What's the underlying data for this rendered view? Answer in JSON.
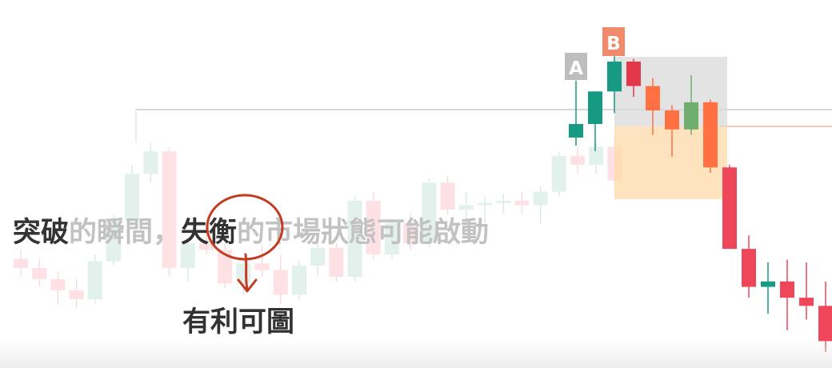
{
  "chart_data": {
    "type": "candlestick",
    "price_scale": [
      0,
      100
    ],
    "background_candles": [
      {
        "o": 38,
        "h": 42,
        "l": 30,
        "c": 34
      },
      {
        "o": 34,
        "h": 38,
        "l": 26,
        "c": 29
      },
      {
        "o": 29,
        "h": 32,
        "l": 18,
        "c": 24
      },
      {
        "o": 24,
        "h": 29,
        "l": 16,
        "c": 20
      },
      {
        "o": 20,
        "h": 40,
        "l": 18,
        "c": 37
      },
      {
        "o": 37,
        "h": 58,
        "l": 35,
        "c": 55
      },
      {
        "o": 55,
        "h": 80,
        "l": 52,
        "c": 76
      },
      {
        "o": 76,
        "h": 90,
        "l": 72,
        "c": 86
      },
      {
        "o": 86,
        "h": 88,
        "l": 30,
        "c": 34
      },
      {
        "o": 34,
        "h": 46,
        "l": 28,
        "c": 45
      },
      {
        "o": 45,
        "h": 52,
        "l": 40,
        "c": 42
      },
      {
        "o": 42,
        "h": 48,
        "l": 25,
        "c": 27
      },
      {
        "o": 27,
        "h": 38,
        "l": 22,
        "c": 36
      },
      {
        "o": 36,
        "h": 44,
        "l": 30,
        "c": 33
      },
      {
        "o": 33,
        "h": 40,
        "l": 18,
        "c": 22
      },
      {
        "o": 22,
        "h": 37,
        "l": 20,
        "c": 35
      },
      {
        "o": 35,
        "h": 46,
        "l": 30,
        "c": 43
      },
      {
        "o": 43,
        "h": 45,
        "l": 28,
        "c": 30
      },
      {
        "o": 30,
        "h": 66,
        "l": 28,
        "c": 64
      },
      {
        "o": 64,
        "h": 68,
        "l": 38,
        "c": 40
      },
      {
        "o": 40,
        "h": 56,
        "l": 38,
        "c": 54
      },
      {
        "o": 54,
        "h": 58,
        "l": 42,
        "c": 45
      },
      {
        "o": 45,
        "h": 74,
        "l": 43,
        "c": 72
      },
      {
        "o": 72,
        "h": 75,
        "l": 58,
        "c": 60
      },
      {
        "o": 60,
        "h": 68,
        "l": 50,
        "c": 62
      },
      {
        "o": 62,
        "h": 66,
        "l": 54,
        "c": 63
      },
      {
        "o": 63,
        "h": 67,
        "l": 58,
        "c": 64
      },
      {
        "o": 64,
        "h": 68,
        "l": 58,
        "c": 62
      },
      {
        "o": 62,
        "h": 70,
        "l": 54,
        "c": 68
      },
      {
        "o": 68,
        "h": 86,
        "l": 66,
        "c": 84
      },
      {
        "o": 84,
        "h": 88,
        "l": 76,
        "c": 80
      },
      {
        "o": 80,
        "h": 90,
        "l": 76,
        "c": 88
      },
      {
        "o": 88,
        "h": 92,
        "l": 70,
        "c": 73
      }
    ],
    "candles": [
      {
        "o": 79,
        "h": 100,
        "l": 76,
        "c": 84
      },
      {
        "o": 84,
        "h": 91,
        "l": 74,
        "c": 96
      },
      {
        "o": 96,
        "h": 112,
        "l": 88,
        "c": 107
      },
      {
        "o": 107,
        "h": 108,
        "l": 94,
        "c": 98
      },
      {
        "o": 98,
        "h": 101,
        "l": 80,
        "c": 89
      },
      {
        "o": 89,
        "h": 91,
        "l": 72,
        "c": 82
      },
      {
        "o": 82,
        "h": 102,
        "l": 80,
        "c": 92
      },
      {
        "o": 92,
        "h": 93,
        "l": 66,
        "c": 68
      },
      {
        "o": 68,
        "h": 69,
        "l": 40,
        "c": 38
      },
      {
        "o": 38,
        "h": 43,
        "l": 20,
        "c": 24
      },
      {
        "o": 24,
        "h": 33,
        "l": 14,
        "c": 26
      },
      {
        "o": 26,
        "h": 34,
        "l": 8,
        "c": 20
      },
      {
        "o": 20,
        "h": 33,
        "l": 12,
        "c": 17
      },
      {
        "o": 17,
        "h": 26,
        "l": 0,
        "c": 4
      }
    ],
    "labels": [
      "A",
      "B"
    ],
    "caption_parts": [
      "突破",
      "的瞬間，",
      "失衡",
      "的市場狀態可能啟動"
    ],
    "annotation": "有利可圖",
    "colors": {
      "up": "#169a84",
      "down": "#f0465a",
      "up_dim": "#6fae6f",
      "down_orange": "#ff7043",
      "ghost_up": "#e3f1ec",
      "ghost_down": "#fde1e4",
      "zone_gray": "#d9d9d9",
      "zone_orange": "#ffd9a8",
      "label_a": "#bdbdbd",
      "label_b": "#f08a6a",
      "circle": "#c23b22",
      "text_dark": "#333333",
      "text_light": "#c2c2c2"
    }
  }
}
